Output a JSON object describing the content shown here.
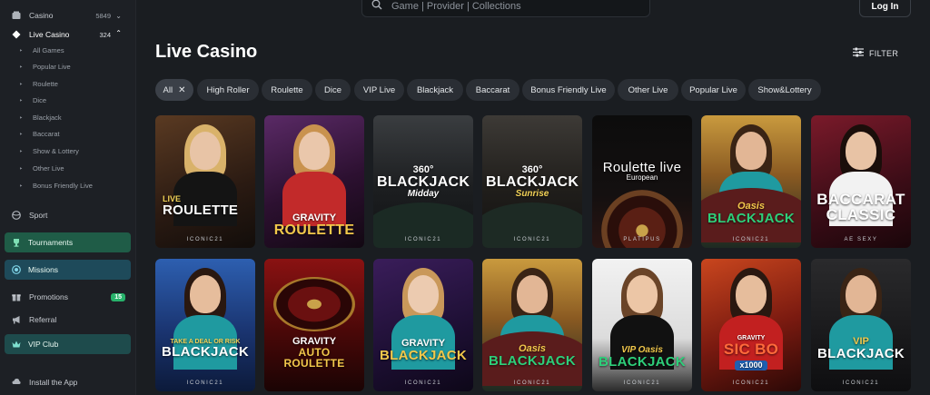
{
  "sidebar": {
    "casino": {
      "label": "Casino",
      "count": "5849"
    },
    "live_casino": {
      "label": "Live Casino",
      "count": "324"
    },
    "sub_items": [
      "All Games",
      "Popular Live",
      "Roulette",
      "Dice",
      "Blackjack",
      "Baccarat",
      "Show & Lottery",
      "Other Live",
      "Bonus Friendly Live"
    ],
    "sport": "Sport",
    "tournaments": "Tournaments",
    "missions": "Missions",
    "promotions": {
      "label": "Promotions",
      "badge": "15"
    },
    "referral": "Referral",
    "vip_club": "VIP Club",
    "install_app": "Install the App"
  },
  "header": {
    "search_placeholder": "Game | Provider | Collections",
    "login_label": "Log In"
  },
  "main": {
    "title": "Live Casino",
    "filter_label": "FILTER",
    "chips": [
      "All",
      "High Roller",
      "Roulette",
      "Dice",
      "VIP Live",
      "Blackjack",
      "Baccarat",
      "Bonus Friendly Live",
      "Other Live",
      "Popular Live",
      "Show&Lottery"
    ],
    "games": [
      {
        "line1": "LIVE",
        "line2": "ROULETTE",
        "provider": "ICONIC21"
      },
      {
        "line1": "GRAVITY",
        "line2": "ROULETTE",
        "provider": ""
      },
      {
        "line1": "360°",
        "line2": "BLACKJACK",
        "line3": "Midday",
        "provider": "ICONIC21"
      },
      {
        "line1": "360°",
        "line2": "BLACKJACK",
        "line3": "Sunrise",
        "provider": "ICONIC21"
      },
      {
        "line1": "Roulette live",
        "line2": "European",
        "provider": "PLATIPUS"
      },
      {
        "line1": "Oasis",
        "line2": "BLACKJACK",
        "provider": "ICONIC21"
      },
      {
        "line1": "BACCARAT",
        "line2": "CLASSIC",
        "provider": "AE SEXY"
      },
      {
        "line1": "TAKE A DEAL OR RISK",
        "line2": "BLACKJACK",
        "provider": "ICONIC21"
      },
      {
        "line1": "GRAVITY",
        "line2": "AUTO ROULETTE",
        "provider": ""
      },
      {
        "line1": "GRAVITY",
        "line2": "BLACKJACK",
        "provider": "ICONIC21"
      },
      {
        "line1": "Oasis",
        "line2": "BLACKJACK",
        "provider": "ICONIC21"
      },
      {
        "line1": "VIP Oasis",
        "line2": "BLACKJACK",
        "provider": "ICONIC21"
      },
      {
        "line1": "GRAVITY",
        "line2": "SIC BO",
        "line3": "x1000",
        "provider": "ICONIC21"
      },
      {
        "line1": "VIP",
        "line2": "BLACKJACK",
        "provider": "ICONIC21"
      }
    ]
  },
  "colors": {
    "bg": "#1a1d21",
    "sidebar_bg": "#1d2025",
    "chip_bg": "#2a2e34",
    "tournaments_bg": "#1f5c47",
    "missions_bg": "#1e4a5a",
    "vip_bg": "#1e4b4c",
    "badge_green": "#27b36b"
  }
}
